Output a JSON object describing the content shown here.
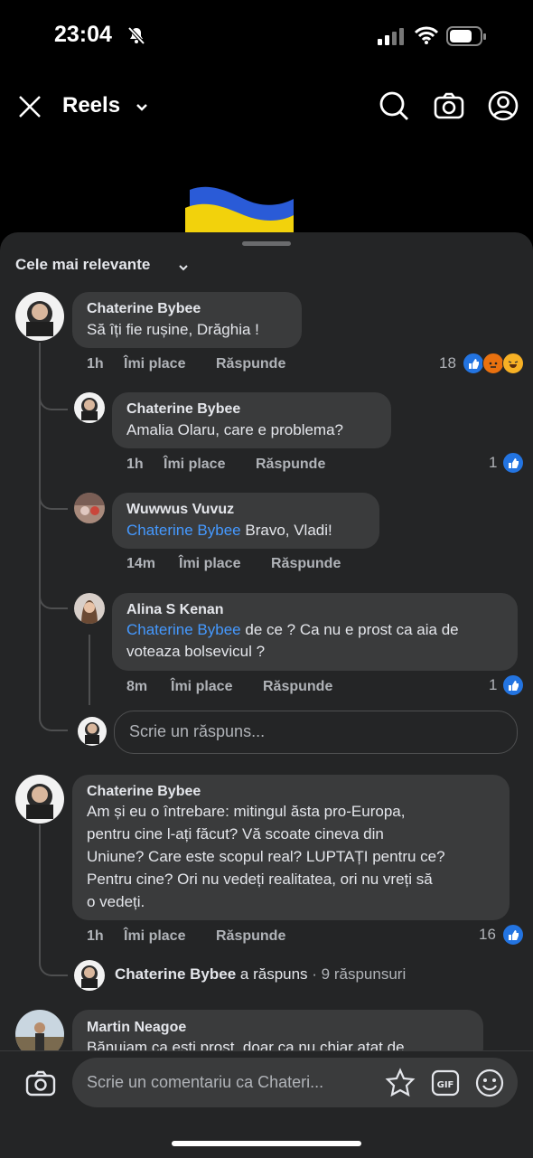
{
  "status": {
    "time": "23:04"
  },
  "header": {
    "title": "Reels",
    "icons": [
      "close-icon",
      "chevron-down-icon",
      "search-icon",
      "camera-icon",
      "profile-icon"
    ]
  },
  "sort_label": "Cele mai relevante",
  "actions": {
    "like": "Îmi place",
    "reply": "Răspunde"
  },
  "comments": [
    {
      "author": "Chaterine Bybee",
      "text": "Să îți fie rușine, Drăghia !",
      "time": "1h",
      "reactions": "18"
    },
    {
      "author": "Chaterine Bybee",
      "text": "Amalia Olaru, care e problema?",
      "time": "1h",
      "reactions": "1"
    },
    {
      "author": "Wuwwus Vuvuz",
      "mention": "Chaterine Bybee",
      "text": " Bravo, Vladi!",
      "time": "14m"
    },
    {
      "author": "Alina S Kenan",
      "mention": "Chaterine Bybee",
      "text_line1": " de ce ? Ca nu e prost ca aia de",
      "text_line2": "voteaza bolsevicul ?",
      "time": "8m",
      "reactions": "1"
    },
    {
      "author": "Chaterine Bybee",
      "lines": [
        "Am și eu o întrebare: mitingul ăsta pro-Europa,",
        "pentru cine l-ați făcut? Vă scoate cineva din",
        "Uniune? Care este scopul real? LUPTAȚI pentru ce?",
        "Pentru cine? Ori nu vedeți realitatea, ori nu vreți să",
        "o vedeți."
      ],
      "time": "1h",
      "reactions": "16"
    },
    {
      "author": "Martin Neagoe",
      "text": "Bănuiam ca ești prost, doar ca nu chiar atat de"
    }
  ],
  "reply_placeholder": "Scrie un răspuns...",
  "replied": {
    "author": "Chaterine Bybee",
    "action": " a răspuns",
    "count": " · 9 răspunsuri"
  },
  "composer": {
    "placeholder": "Scrie un comentariu ca Chateri...",
    "gif": "GIF"
  },
  "colors": {
    "background": "#000000",
    "sheet": "#242526",
    "bubble": "#3a3b3c",
    "mention": "#4599ff",
    "like": "#2374e1"
  }
}
